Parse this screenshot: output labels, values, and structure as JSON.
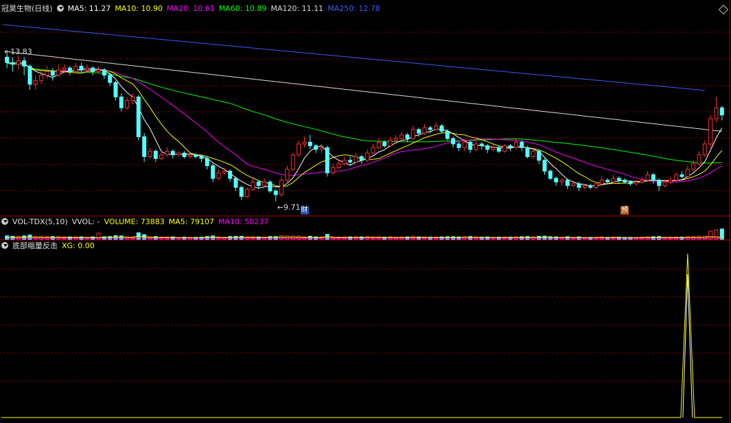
{
  "main": {
    "stock": "冠昊生物(日线)",
    "ma": [
      {
        "label": "MA5: 11.27",
        "color": "#ffffff"
      },
      {
        "label": "MA10: 10.90",
        "color": "#ffff00"
      },
      {
        "label": "MA20: 10.61",
        "color": "#ff00ff"
      },
      {
        "label": "MA60: 10.89",
        "color": "#00ff00"
      },
      {
        "label": "MA120: 11.11",
        "color": "#dddddd"
      },
      {
        "label": "MA250: 12.78",
        "color": "#3b5bff"
      }
    ],
    "high_label": "13.83",
    "low_label": "9.71",
    "marker_cai": "财",
    "marker_yu": "预"
  },
  "vol": {
    "title": "VOL-TDX(5,10)",
    "vvol": "VVOL: -",
    "volume": "VOLUME: 73883",
    "ma5": "MA5: 79107",
    "ma10": "MA10: 50237"
  },
  "ind": {
    "title": "底部缩量反击",
    "xg": "XG: 0.00"
  },
  "colors": {
    "up": "#ff3232",
    "down": "#54ffff",
    "ma5": "#ffffff",
    "ma10": "#ffff00",
    "ma20": "#ff00ff",
    "ma60": "#00ff00",
    "ma120": "#dddddd",
    "ma250": "#3b5bff",
    "grid": "#8b0000"
  },
  "chart_data": {
    "type": "candlestick",
    "price_range": [
      9.5,
      14.9
    ],
    "high_label_value": 13.83,
    "low_label_value": 9.71,
    "candles": [
      [
        13.7,
        13.55,
        13.9,
        13.4
      ],
      [
        13.55,
        13.5,
        13.7,
        13.3
      ],
      [
        13.5,
        13.6,
        13.75,
        13.35
      ],
      [
        13.6,
        13.45,
        13.7,
        13.2
      ],
      [
        13.45,
        12.95,
        13.5,
        12.8
      ],
      [
        12.95,
        13.05,
        13.2,
        12.8
      ],
      [
        13.05,
        13.2,
        13.35,
        12.95
      ],
      [
        13.2,
        13.3,
        13.45,
        13.1
      ],
      [
        13.3,
        13.2,
        13.4,
        13.05
      ],
      [
        13.2,
        13.35,
        13.5,
        13.15
      ],
      [
        13.35,
        13.4,
        13.5,
        13.25
      ],
      [
        13.4,
        13.3,
        13.45,
        13.2
      ],
      [
        13.3,
        13.45,
        13.55,
        13.25
      ],
      [
        13.45,
        13.35,
        13.55,
        13.3
      ],
      [
        13.35,
        13.4,
        13.5,
        13.3
      ],
      [
        13.4,
        13.3,
        13.45,
        13.2
      ],
      [
        13.3,
        13.35,
        13.45,
        13.25
      ],
      [
        13.35,
        13.2,
        13.4,
        13.1
      ],
      [
        13.2,
        13.0,
        13.25,
        12.9
      ],
      [
        13.0,
        12.6,
        13.05,
        12.5
      ],
      [
        12.6,
        12.3,
        12.7,
        12.2
      ],
      [
        12.3,
        12.5,
        12.6,
        12.25
      ],
      [
        12.5,
        12.6,
        12.7,
        12.4
      ],
      [
        12.6,
        11.5,
        12.65,
        11.4
      ],
      [
        11.5,
        10.95,
        11.6,
        10.8
      ],
      [
        10.95,
        11.1,
        11.2,
        10.9
      ],
      [
        11.1,
        10.9,
        11.15,
        10.8
      ],
      [
        10.9,
        11.0,
        11.1,
        10.85
      ],
      [
        11.0,
        11.1,
        11.2,
        10.95
      ],
      [
        11.1,
        11.0,
        11.15,
        10.9
      ],
      [
        11.0,
        11.05,
        11.1,
        10.95
      ],
      [
        11.05,
        10.95,
        11.1,
        10.9
      ],
      [
        10.95,
        11.0,
        11.05,
        10.9
      ],
      [
        11.0,
        10.95,
        11.05,
        10.9
      ],
      [
        10.95,
        10.9,
        11.0,
        10.8
      ],
      [
        10.9,
        10.7,
        10.95,
        10.6
      ],
      [
        10.7,
        10.35,
        10.75,
        10.25
      ],
      [
        10.35,
        10.5,
        10.6,
        10.3
      ],
      [
        10.5,
        10.55,
        10.65,
        10.45
      ],
      [
        10.55,
        10.35,
        10.6,
        10.25
      ],
      [
        10.35,
        10.1,
        10.4,
        10.0
      ],
      [
        10.1,
        9.85,
        10.15,
        9.75
      ],
      [
        9.85,
        10.05,
        10.1,
        9.8
      ],
      [
        10.05,
        10.25,
        10.35,
        10.0
      ],
      [
        10.25,
        10.15,
        10.3,
        10.05
      ],
      [
        10.15,
        10.25,
        10.35,
        10.1
      ],
      [
        10.25,
        10.0,
        10.3,
        9.95
      ],
      [
        10.0,
        9.9,
        10.05,
        9.71
      ],
      [
        9.9,
        10.3,
        10.4,
        9.85
      ],
      [
        10.3,
        10.6,
        10.7,
        10.2
      ],
      [
        10.6,
        11.0,
        11.05,
        10.55
      ],
      [
        11.0,
        11.3,
        11.4,
        10.95
      ],
      [
        11.3,
        11.35,
        11.5,
        11.2
      ],
      [
        11.35,
        11.25,
        11.55,
        11.15
      ],
      [
        11.25,
        11.15,
        11.3,
        11.05
      ],
      [
        11.15,
        11.2,
        11.3,
        11.05
      ],
      [
        11.2,
        10.5,
        11.25,
        10.4
      ],
      [
        10.5,
        10.65,
        10.75,
        10.45
      ],
      [
        10.65,
        10.75,
        10.85,
        10.6
      ],
      [
        10.75,
        10.85,
        10.95,
        10.7
      ],
      [
        10.85,
        10.8,
        10.95,
        10.7
      ],
      [
        10.8,
        10.95,
        11.05,
        10.75
      ],
      [
        10.95,
        10.85,
        11.0,
        10.75
      ],
      [
        10.85,
        11.05,
        11.15,
        10.8
      ],
      [
        11.05,
        11.2,
        11.3,
        11.0
      ],
      [
        11.2,
        11.35,
        11.45,
        11.15
      ],
      [
        11.35,
        11.25,
        11.4,
        11.2
      ],
      [
        11.25,
        11.4,
        11.5,
        11.2
      ],
      [
        11.4,
        11.45,
        11.55,
        11.35
      ],
      [
        11.45,
        11.55,
        11.65,
        11.4
      ],
      [
        11.55,
        11.45,
        11.6,
        11.35
      ],
      [
        11.45,
        11.7,
        11.8,
        11.4
      ],
      [
        11.7,
        11.6,
        11.75,
        11.5
      ],
      [
        11.6,
        11.75,
        11.85,
        11.55
      ],
      [
        11.75,
        11.7,
        11.8,
        11.6
      ],
      [
        11.7,
        11.8,
        11.9,
        11.65
      ],
      [
        11.8,
        11.65,
        11.85,
        11.6
      ],
      [
        11.65,
        11.45,
        11.7,
        11.4
      ],
      [
        11.45,
        11.3,
        11.5,
        11.2
      ],
      [
        11.3,
        11.2,
        11.35,
        11.1
      ],
      [
        11.2,
        11.35,
        11.45,
        11.1
      ],
      [
        11.35,
        11.15,
        11.4,
        11.05
      ],
      [
        11.15,
        11.3,
        11.4,
        11.1
      ],
      [
        11.3,
        11.25,
        11.35,
        11.15
      ],
      [
        11.25,
        11.15,
        11.3,
        11.05
      ],
      [
        11.15,
        11.2,
        11.3,
        11.1
      ],
      [
        11.2,
        11.1,
        11.25,
        11.05
      ],
      [
        11.1,
        11.25,
        11.3,
        11.05
      ],
      [
        11.25,
        11.2,
        11.3,
        11.1
      ],
      [
        11.2,
        11.35,
        11.45,
        11.15
      ],
      [
        11.35,
        11.2,
        11.4,
        11.1
      ],
      [
        11.2,
        10.95,
        11.25,
        10.9
      ],
      [
        10.95,
        11.1,
        11.2,
        10.9
      ],
      [
        11.1,
        10.85,
        11.15,
        10.75
      ],
      [
        10.85,
        10.55,
        10.9,
        10.45
      ],
      [
        10.55,
        10.35,
        10.6,
        10.3
      ],
      [
        10.35,
        10.25,
        10.4,
        10.15
      ],
      [
        10.25,
        10.3,
        10.35,
        10.15
      ],
      [
        10.3,
        10.15,
        10.35,
        10.05
      ],
      [
        10.15,
        10.2,
        10.3,
        10.1
      ],
      [
        10.2,
        10.1,
        10.25,
        10.0
      ],
      [
        10.1,
        10.15,
        10.2,
        10.05
      ],
      [
        10.15,
        10.1,
        10.2,
        10.05
      ],
      [
        10.1,
        10.2,
        10.25,
        10.05
      ],
      [
        10.2,
        10.3,
        10.4,
        10.15
      ],
      [
        10.3,
        10.25,
        10.35,
        10.2
      ],
      [
        10.25,
        10.35,
        10.45,
        10.2
      ],
      [
        10.35,
        10.3,
        10.4,
        10.2
      ],
      [
        10.3,
        10.25,
        10.35,
        10.2
      ],
      [
        10.25,
        10.2,
        10.3,
        10.15
      ],
      [
        10.2,
        10.25,
        10.3,
        10.15
      ],
      [
        10.25,
        10.3,
        10.4,
        10.2
      ],
      [
        10.3,
        10.45,
        10.55,
        10.25
      ],
      [
        10.45,
        10.3,
        10.5,
        10.2
      ],
      [
        10.3,
        10.15,
        10.35,
        10.0
      ],
      [
        10.15,
        10.25,
        10.3,
        10.1
      ],
      [
        10.25,
        10.3,
        10.4,
        10.2
      ],
      [
        10.3,
        10.45,
        10.5,
        10.25
      ],
      [
        10.45,
        10.4,
        10.55,
        10.35
      ],
      [
        10.4,
        10.6,
        10.7,
        10.35
      ],
      [
        10.6,
        10.75,
        10.85,
        10.5
      ],
      [
        10.75,
        11.0,
        11.1,
        10.7
      ],
      [
        11.0,
        11.3,
        11.4,
        10.95
      ],
      [
        11.3,
        12.0,
        12.1,
        11.2
      ],
      [
        12.0,
        12.3,
        12.6,
        11.9
      ],
      [
        12.3,
        12.1,
        12.35,
        11.95
      ]
    ],
    "ma250_points": [
      [
        0,
        14.6
      ],
      [
        122,
        12.78
      ]
    ],
    "volume_range": [
      0,
      800000
    ],
    "xg_series": "zero everywhere except a single spike to 1 near the end",
    "xg_range": [
      0,
      1.1
    ]
  }
}
